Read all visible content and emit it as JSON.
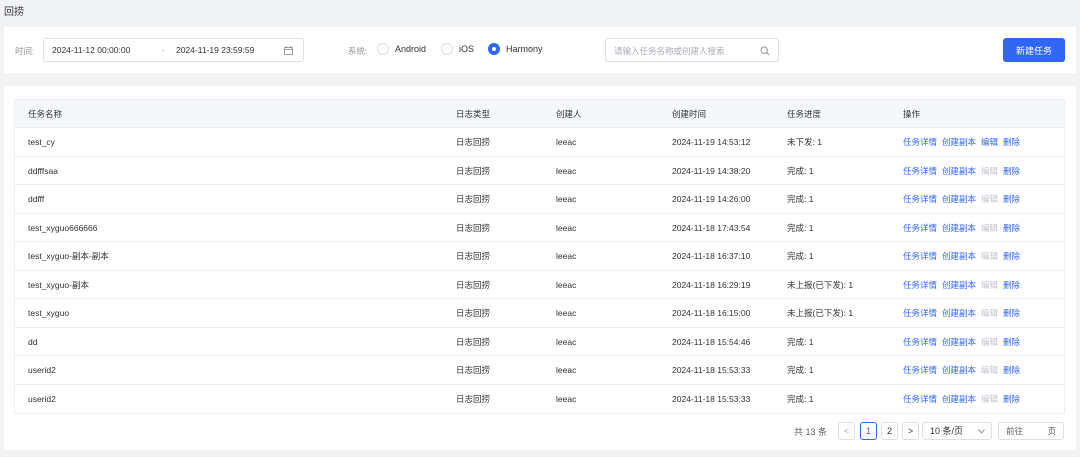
{
  "page": {
    "title": "回捞"
  },
  "filters": {
    "time_label": "时间:",
    "date_start": "2024-11-12 00:00:00",
    "date_sep": "-",
    "date_end": "2024-11-19 23:59:59",
    "system_label": "系统:",
    "systems": [
      {
        "label": "Android",
        "checked": false
      },
      {
        "label": "iOS",
        "checked": false
      },
      {
        "label": "Harmony",
        "checked": true
      }
    ],
    "search_placeholder": "请输入任务名称或创建人搜索",
    "new_task_label": "新建任务"
  },
  "table": {
    "headers": [
      "任务名称",
      "日志类型",
      "创建人",
      "创建时间",
      "任务进度",
      "操作"
    ],
    "rows": [
      {
        "name": "test_cy",
        "type": "日志回捞",
        "creator": "leeac",
        "time": "2024-11-19 14:53:12",
        "progress": "未下发: 1",
        "edit_enabled": true
      },
      {
        "name": "ddfffsaa",
        "type": "日志回捞",
        "creator": "leeac",
        "time": "2024-11-19 14:38:20",
        "progress": "完成: 1",
        "edit_enabled": false
      },
      {
        "name": "ddfff",
        "type": "日志回捞",
        "creator": "leeac",
        "time": "2024-11-19 14:26:00",
        "progress": "完成: 1",
        "edit_enabled": false
      },
      {
        "name": "test_xyguo666666",
        "type": "日志回捞",
        "creator": "leeac",
        "time": "2024-11-18 17:43:54",
        "progress": "完成: 1",
        "edit_enabled": false
      },
      {
        "name": "test_xyguo-副本-副本",
        "type": "日志回捞",
        "creator": "leeac",
        "time": "2024-11-18 16:37:10",
        "progress": "完成: 1",
        "edit_enabled": false
      },
      {
        "name": "test_xyguo-副本",
        "type": "日志回捞",
        "creator": "leeac",
        "time": "2024-11-18 16:29:19",
        "progress": "未上报(已下发): 1",
        "edit_enabled": false
      },
      {
        "name": "test_xyguo",
        "type": "日志回捞",
        "creator": "leeac",
        "time": "2024-11-18 16:15:00",
        "progress": "未上报(已下发): 1",
        "edit_enabled": false
      },
      {
        "name": "dd",
        "type": "日志回捞",
        "creator": "leeac",
        "time": "2024-11-18 15:54:46",
        "progress": "完成: 1",
        "edit_enabled": false
      },
      {
        "name": "userid2",
        "type": "日志回捞",
        "creator": "leeac",
        "time": "2024-11-18 15:53:33",
        "progress": "完成: 1",
        "edit_enabled": false
      },
      {
        "name": "userid2",
        "type": "日志回捞",
        "creator": "leeac",
        "time": "2024-11-18 15:53:33",
        "progress": "完成: 1",
        "edit_enabled": false
      }
    ],
    "actions": {
      "detail": "任务详情",
      "copy": "创建副本",
      "edit": "编辑",
      "delete": "删除"
    }
  },
  "pagination": {
    "total": "共 13 条",
    "prev": "<",
    "pages": [
      "1",
      "2"
    ],
    "current": "1",
    "next": ">",
    "page_size": "10 条/页",
    "goto_label": "前往",
    "goto_suffix": "页"
  },
  "colors": {
    "primary": "#3166f5",
    "disabled": "#c0c4cc"
  }
}
